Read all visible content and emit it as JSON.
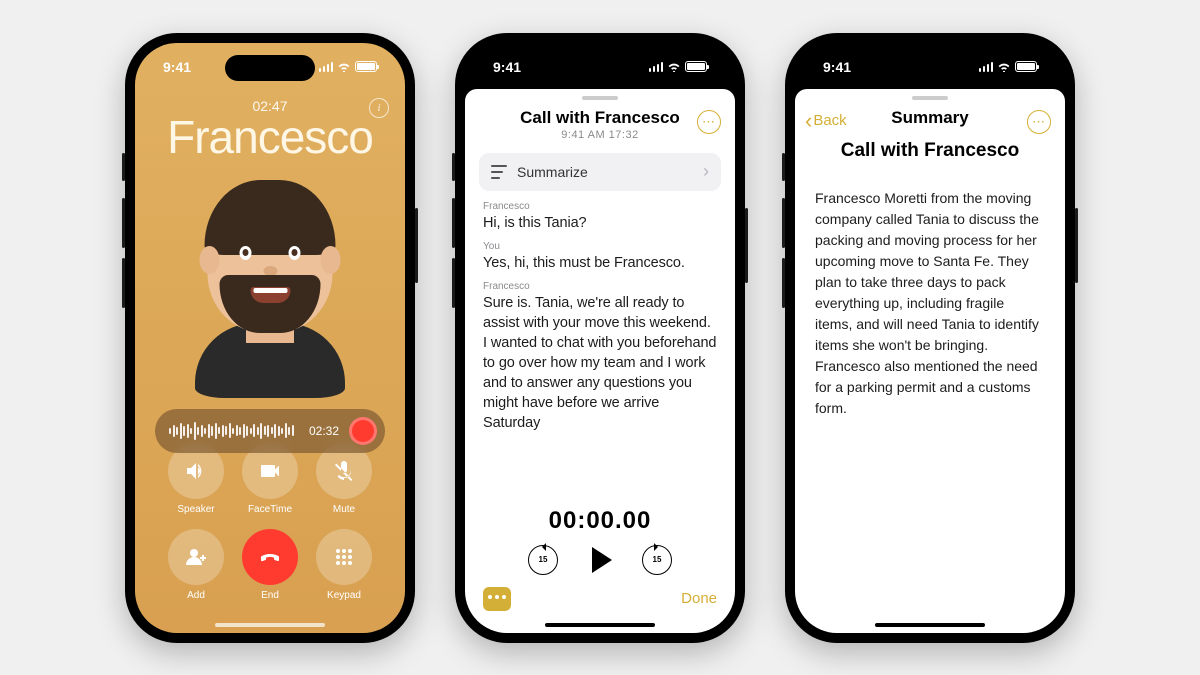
{
  "status": {
    "time": "9:41"
  },
  "phone1": {
    "call_duration": "02:47",
    "caller_name": "Francesco",
    "recording_time": "02:32",
    "controls": {
      "speaker": "Speaker",
      "facetime": "FaceTime",
      "mute": "Mute",
      "add": "Add",
      "end": "End",
      "keypad": "Keypad"
    }
  },
  "phone2": {
    "title": "Call with Francesco",
    "subtitle": "9:41 AM  17:32",
    "summarize_label": "Summarize",
    "transcript": [
      {
        "speaker": "Francesco",
        "text": "Hi, is this Tania?"
      },
      {
        "speaker": "You",
        "text": "Yes, hi, this must be Francesco."
      },
      {
        "speaker": "Francesco",
        "text": "Sure is. Tania, we're all ready to assist with your move this weekend. I wanted to chat with you beforehand to go over how my team and I work and to answer any questions you might have before we arrive Saturday"
      }
    ],
    "player_time": "00:00.00",
    "skip_seconds": "15",
    "done_label": "Done"
  },
  "phone3": {
    "back_label": "Back",
    "nav_title": "Summary",
    "heading": "Call with Francesco",
    "summary_text": "Francesco Moretti from the moving company called Tania to discuss the packing and moving process for her upcoming move to Santa Fe. They plan to take three days to pack everything up, including fragile items, and will need Tania to identify items she won't be bringing. Francesco also mentioned the need for a parking permit and a customs form."
  }
}
